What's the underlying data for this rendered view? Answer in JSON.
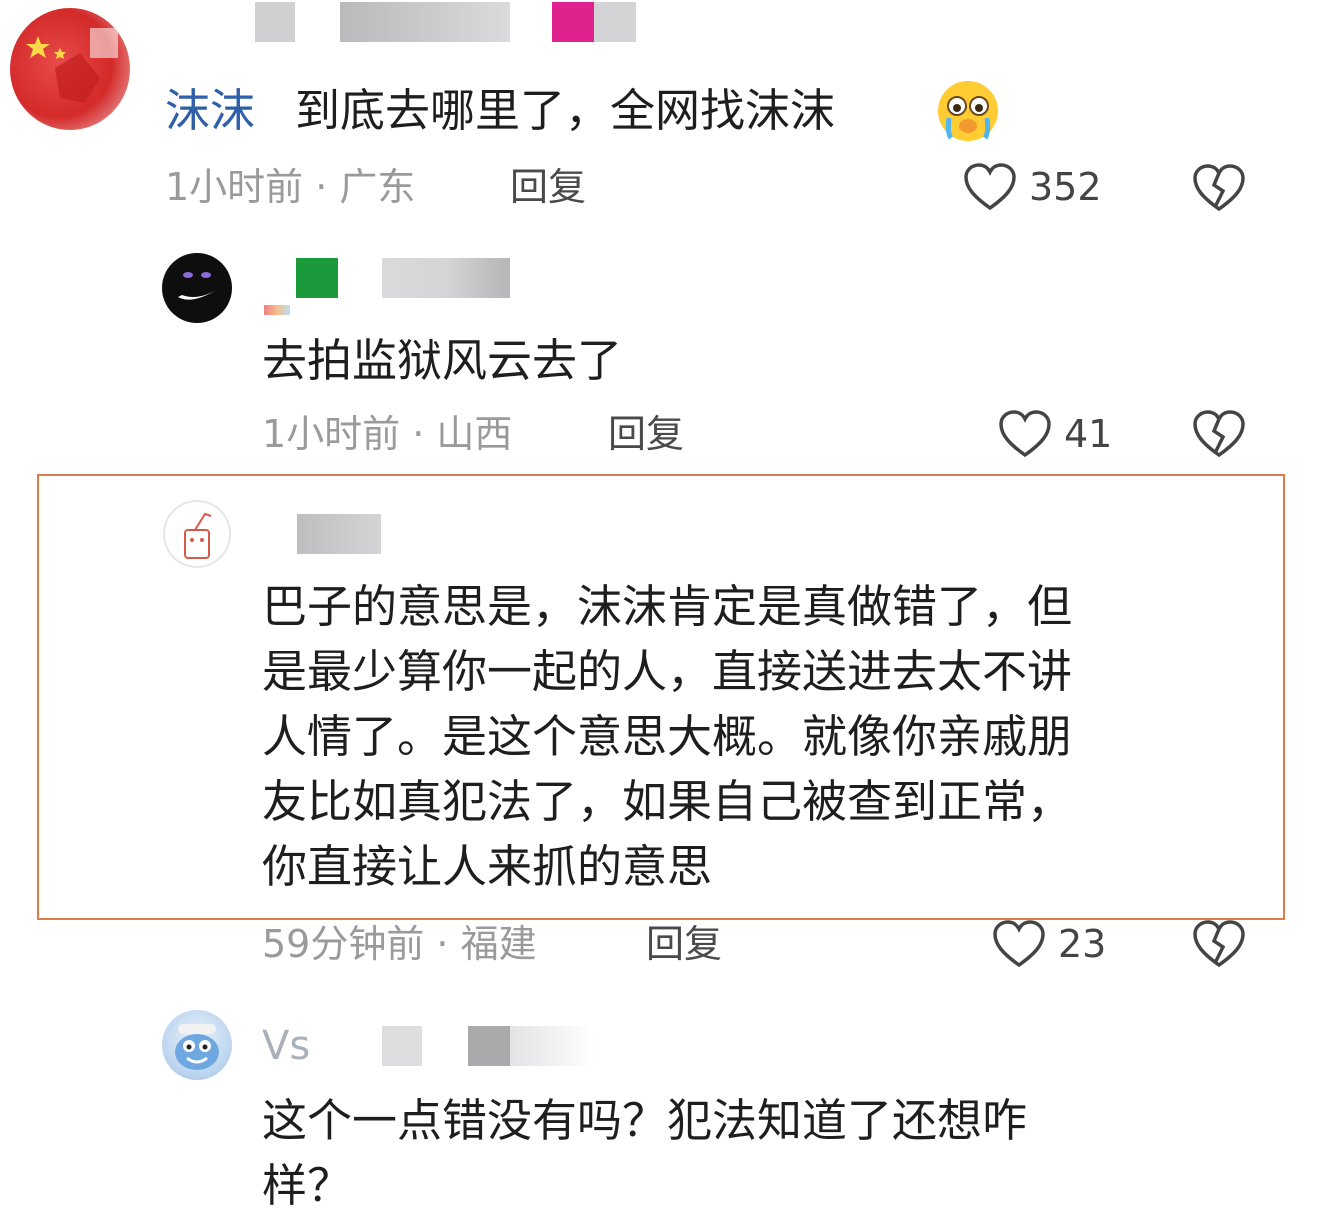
{
  "comments": [
    {
      "text_prefix": "沫沫",
      "text_main": "到底去哪里了，全网找沫沫",
      "time_location": "1小时前 · 广东",
      "reply_label": "回复",
      "likes": "352",
      "emoji_icon": "crying-face-icon"
    },
    {
      "text": "去拍监狱风云去了",
      "time_location": "1小时前 · 山西",
      "reply_label": "回复",
      "likes": "41"
    },
    {
      "lines": [
        "巴子的意思是，沫沫肯定是真做错了，但",
        "是最少算你一起的人，直接送进去太不讲",
        "人情了。是这个意思大概。就像你亲戚朋",
        "友比如真犯法了，如果自己被查到正常，",
        "你直接让人来抓的意思"
      ],
      "time_location": "59分钟前 · 福建",
      "reply_label": "回复",
      "likes": "23",
      "highlighted": true,
      "highlight_color": "#e07a4a"
    },
    {
      "username": "Vs",
      "lines": [
        "这个一点错没有吗？犯法知道了还想咋",
        "样？"
      ]
    }
  ],
  "colors": {
    "meta_text": "#9a9a9a",
    "mention_blue": "#2e5fa8",
    "highlight_border": "#e07a4a"
  }
}
